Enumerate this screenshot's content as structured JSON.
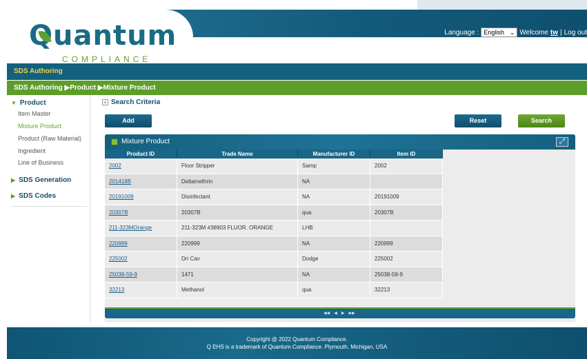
{
  "header": {
    "logo_main": "Quantum",
    "logo_sub": "COMPLIANCE",
    "language_label": "Language :",
    "language_selected": "English",
    "welcome_text": "Welcome",
    "username": "tw",
    "separator": "|",
    "logout_label": "Log out"
  },
  "module_bar": {
    "title": "SDS Authoring"
  },
  "breadcrumb": {
    "text": "SDS Authoring ▶Product ▶Mixture Product"
  },
  "sidebar": {
    "product_label": "Product",
    "items": [
      "Item Master",
      "Mixture Product",
      "Product (Raw Material)",
      "Ingredient",
      "Line of Business"
    ],
    "active_item": "Mixture Product",
    "sds_generation_label": "SDS Generation",
    "sds_codes_label": "SDS Codes"
  },
  "search": {
    "criteria_label": "Search Criteria",
    "plus_symbol": "+"
  },
  "buttons": {
    "add": "Add",
    "reset": "Reset",
    "search": "Search"
  },
  "grid": {
    "title": "Mixture Product",
    "columns": [
      "Product ID",
      "Trade Name",
      "Manufacturer ID",
      "Item ID"
    ],
    "rows": [
      [
        "2002",
        "Floor Stripper",
        "Samp",
        "2002"
      ],
      [
        "201418B",
        "Deltamethrin",
        "NA",
        ""
      ],
      [
        "20191009",
        "Disinfectant",
        "NA",
        "20191009"
      ],
      [
        "20307B",
        "20307B",
        "qua",
        "20307B"
      ],
      [
        "211-323MOrange",
        "211-323M #38903 FLUOR. ORANGE",
        "LHB",
        ""
      ],
      [
        "220999",
        "220999",
        "NA",
        "220999"
      ],
      [
        "225002",
        "Dri Cav",
        "Dodge",
        "225002"
      ],
      [
        "25038-59-9",
        "1471",
        "NA",
        "25038-59-9"
      ],
      [
        "32213",
        "Methanol",
        "qua",
        "32213"
      ]
    ],
    "pager": [
      "◀◀",
      "◀",
      "▶",
      "▶▶"
    ]
  },
  "footer": {
    "line1": "Copyright @ 2022 Quantum Compliance.",
    "line2": "Q EHS is a trademark of Quantum Compliance. Plymouth, Michigan, USA"
  },
  "colors": {
    "brand_blue": "#14607f",
    "brand_green": "#5d9e2a",
    "link": "#1a5d8c",
    "accent_yellow": "#f2d34a"
  }
}
